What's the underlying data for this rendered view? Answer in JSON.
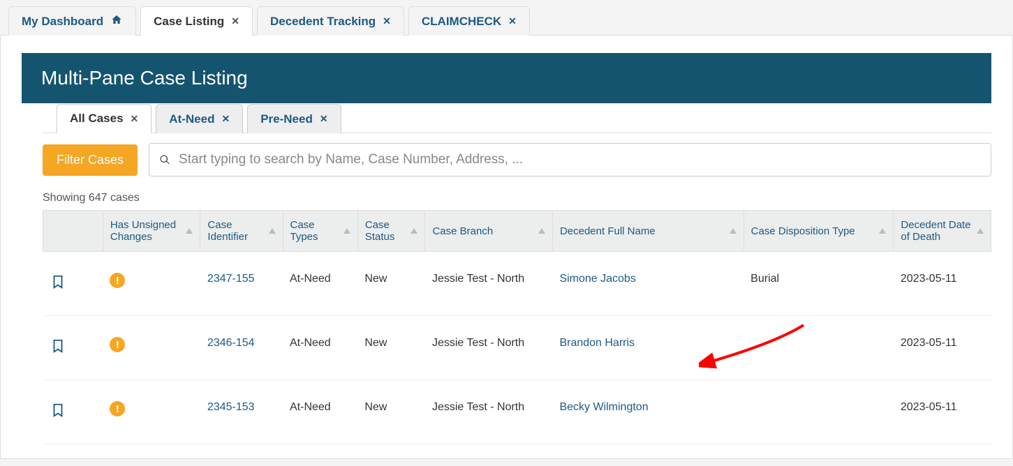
{
  "top_tabs": [
    {
      "label": "My Dashboard",
      "closable": false,
      "home": true
    },
    {
      "label": "Case Listing",
      "closable": true,
      "active": true
    },
    {
      "label": "Decedent Tracking",
      "closable": true
    },
    {
      "label": "CLAIMCHECK",
      "closable": true
    }
  ],
  "page_title": "Multi-Pane Case Listing",
  "sub_tabs": [
    {
      "label": "All Cases",
      "active": true
    },
    {
      "label": "At-Need"
    },
    {
      "label": "Pre-Need"
    }
  ],
  "filter_button": "Filter Cases",
  "search_placeholder": "Start typing to search by Name, Case Number, Address, ...",
  "showing_text": "Showing 647 cases",
  "columns": {
    "unsigned": "Has Unsigned Changes",
    "identifier": "Case Identifier",
    "types": "Case Types",
    "status": "Case Status",
    "branch": "Case Branch",
    "name": "Decedent Full Name",
    "disposition": "Case Disposition Type",
    "death": "Decedent Date of Death"
  },
  "rows": [
    {
      "unsigned": true,
      "identifier": "2347-155",
      "types": "At-Need",
      "status": "New",
      "branch": "Jessie Test - North",
      "name": "Simone Jacobs",
      "disposition": "Burial",
      "death": "2023-05-11"
    },
    {
      "unsigned": true,
      "identifier": "2346-154",
      "types": "At-Need",
      "status": "New",
      "branch": "Jessie Test - North",
      "name": "Brandon Harris",
      "disposition": "",
      "death": "2023-05-11"
    },
    {
      "unsigned": true,
      "identifier": "2345-153",
      "types": "At-Need",
      "status": "New",
      "branch": "Jessie Test - North",
      "name": "Becky Wilmington",
      "disposition": "",
      "death": "2023-05-11"
    }
  ]
}
